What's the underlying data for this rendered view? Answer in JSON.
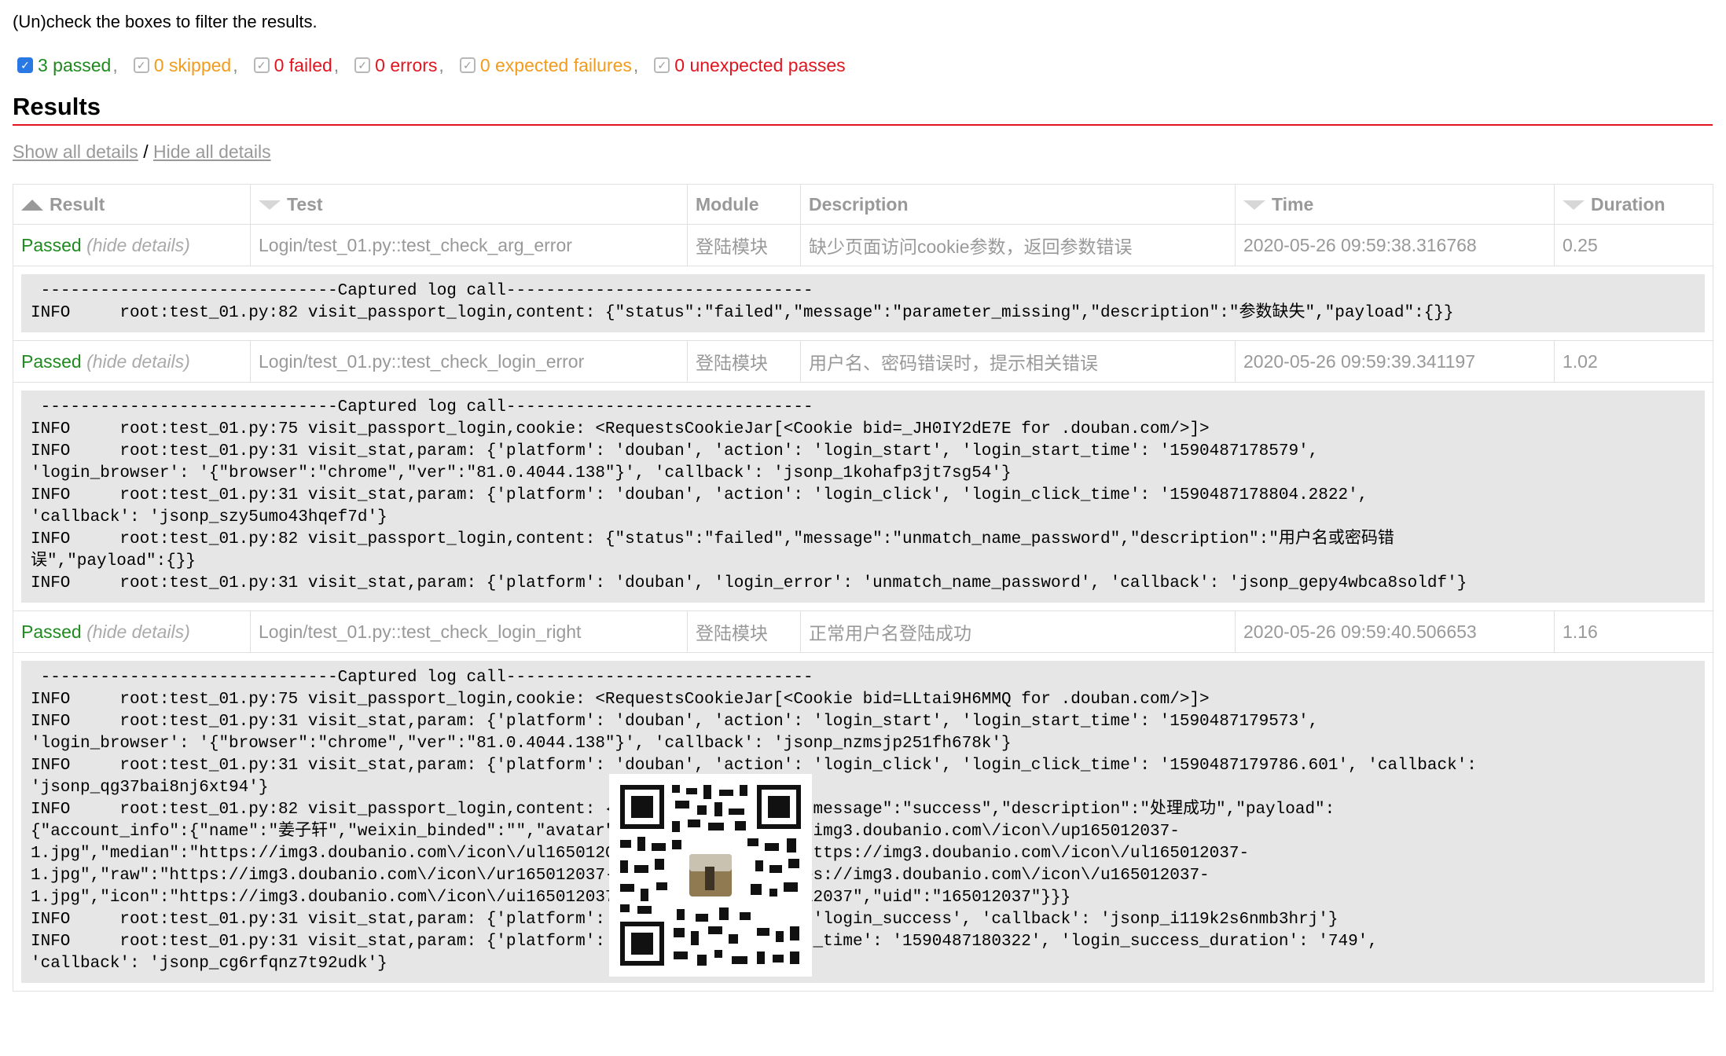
{
  "intro": "(Un)check the boxes to filter the results.",
  "filters": [
    {
      "label": "3 passed",
      "checked": true,
      "color": "#1f8a1f"
    },
    {
      "label": "0 skipped",
      "checked": false,
      "color": "#f29b1d"
    },
    {
      "label": "0 failed",
      "checked": false,
      "color": "#e0151f"
    },
    {
      "label": "0 errors",
      "checked": false,
      "color": "#e0151f"
    },
    {
      "label": "0 expected failures",
      "checked": false,
      "color": "#f29b1d"
    },
    {
      "label": "0 unexpected passes",
      "checked": false,
      "color": "#e0151f"
    }
  ],
  "results_heading": "Results",
  "links": {
    "show": "Show all details",
    "slash": "/",
    "hide": "Hide all details"
  },
  "columns": [
    "Result",
    "Test",
    "Module",
    "Description",
    "Time",
    "Duration"
  ],
  "rows": [
    {
      "result": "Passed",
      "toggle": "(hide details)",
      "test": "Login/test_01.py::test_check_arg_error",
      "module": "登陆模块",
      "description": "缺少页面访问cookie参数，返回参数错误",
      "time": "2020-05-26 09:59:38.316768",
      "duration": "0.25",
      "log": " ------------------------------Captured log call-------------------------------\nINFO     root:test_01.py:82 visit_passport_login,content: {\"status\":\"failed\",\"message\":\"parameter_missing\",\"description\":\"参数缺失\",\"payload\":{}}"
    },
    {
      "result": "Passed",
      "toggle": "(hide details)",
      "test": "Login/test_01.py::test_check_login_error",
      "module": "登陆模块",
      "description": "用户名、密码错误时，提示相关错误",
      "time": "2020-05-26 09:59:39.341197",
      "duration": "1.02",
      "log": " ------------------------------Captured log call-------------------------------\nINFO     root:test_01.py:75 visit_passport_login,cookie: <RequestsCookieJar[<Cookie bid=_JH0IY2dE7E for .douban.com/>]>\nINFO     root:test_01.py:31 visit_stat,param: {'platform': 'douban', 'action': 'login_start', 'login_start_time': '1590487178579',\n'login_browser': '{\"browser\":\"chrome\",\"ver\":\"81.0.4044.138\"}', 'callback': 'jsonp_1kohafp3jt7sg54'}\nINFO     root:test_01.py:31 visit_stat,param: {'platform': 'douban', 'action': 'login_click', 'login_click_time': '1590487178804.2822',\n'callback': 'jsonp_szy5umo43hqef7d'}\nINFO     root:test_01.py:82 visit_passport_login,content: {\"status\":\"failed\",\"message\":\"unmatch_name_password\",\"description\":\"用户名或密码错\n误\",\"payload\":{}}\nINFO     root:test_01.py:31 visit_stat,param: {'platform': 'douban', 'login_error': 'unmatch_name_password', 'callback': 'jsonp_gepy4wbca8soldf'}"
    },
    {
      "result": "Passed",
      "toggle": "(hide details)",
      "test": "Login/test_01.py::test_check_login_right",
      "module": "登陆模块",
      "description": "正常用户名登陆成功",
      "time": "2020-05-26 09:59:40.506653",
      "duration": "1.16",
      "log": " ------------------------------Captured log call-------------------------------\nINFO     root:test_01.py:75 visit_passport_login,cookie: <RequestsCookieJar[<Cookie bid=LLtai9H6MMQ for .douban.com/>]>\nINFO     root:test_01.py:31 visit_stat,param: {'platform': 'douban', 'action': 'login_start', 'login_start_time': '1590487179573',\n'login_browser': '{\"browser\":\"chrome\",\"ver\":\"81.0.4044.138\"}', 'callback': 'jsonp_nzmsjp251fh678k'}\nINFO     root:test_01.py:31 visit_stat,param: {'platform': 'douban', 'action': 'login_click', 'login_click_time': '1590487179786.601', 'callback':\n'jsonp_qg37bai8nj6xt94'}\nINFO     root:test_01.py:82 visit_passport_login,content: {\"status\":\"success\",\"message\":\"success\",\"description\":\"处理成功\",\"payload\":\n{\"account_info\":{\"name\":\"姜子轩\",\"weixin_binded\":\"\",\"avatar\":{\"medium\":\"https://img3.doubanio.com\\/icon\\/up165012037-\n1.jpg\",\"median\":\"https://img3.doubanio.com\\/icon\\/ul165012037-1.jpg\",\"large\":\"https://img3.doubanio.com\\/icon\\/ul165012037-\n1.jpg\",\"raw\":\"https://img3.doubanio.com\\/icon\\/ur165012037-1.jpg\",\"small\":\"https://img3.doubanio.com\\/icon\\/u165012037-\n1.jpg\",\"icon\":\"https://img3.doubanio.com\\/icon\\/ui165012037-1.jpg\"},\"id\":\"165012037\",\"uid\":\"165012037\"}}}\nINFO     root:test_01.py:31 visit_stat,param: {'platform': 'douban', 'action': 'login_success', 'callback': 'jsonp_i119k2s6nmb3hrj'}\nINFO     root:test_01.py:31 visit_stat,param: {'platform': 'douban', 'login_end_time': '1590487180322', 'login_success_duration': '749',\n'callback': 'jsonp_cg6rfqnz7t92udk'}"
    }
  ]
}
